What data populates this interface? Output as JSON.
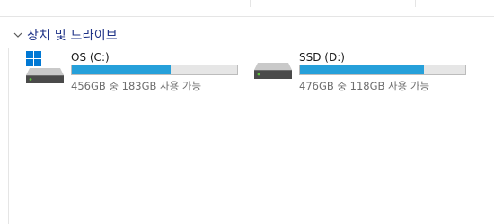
{
  "group": {
    "title": "장치 및 드라이브",
    "expanded": true
  },
  "drives": [
    {
      "name": "OS (C:)",
      "space_text": "456GB 중 183GB 사용 가능",
      "used_fraction": 0.599,
      "icon": "windows-drive-icon"
    },
    {
      "name": "SSD (D:)",
      "space_text": "476GB 중 118GB 사용 가능",
      "used_fraction": 0.752,
      "icon": "hard-drive-icon"
    }
  ],
  "colors": {
    "group_title": "#1e3287",
    "usage_fill": "#26a0da",
    "usage_track": "#e6e6e6",
    "windows_logo": "#0078d4",
    "led": "#5cc23c"
  }
}
